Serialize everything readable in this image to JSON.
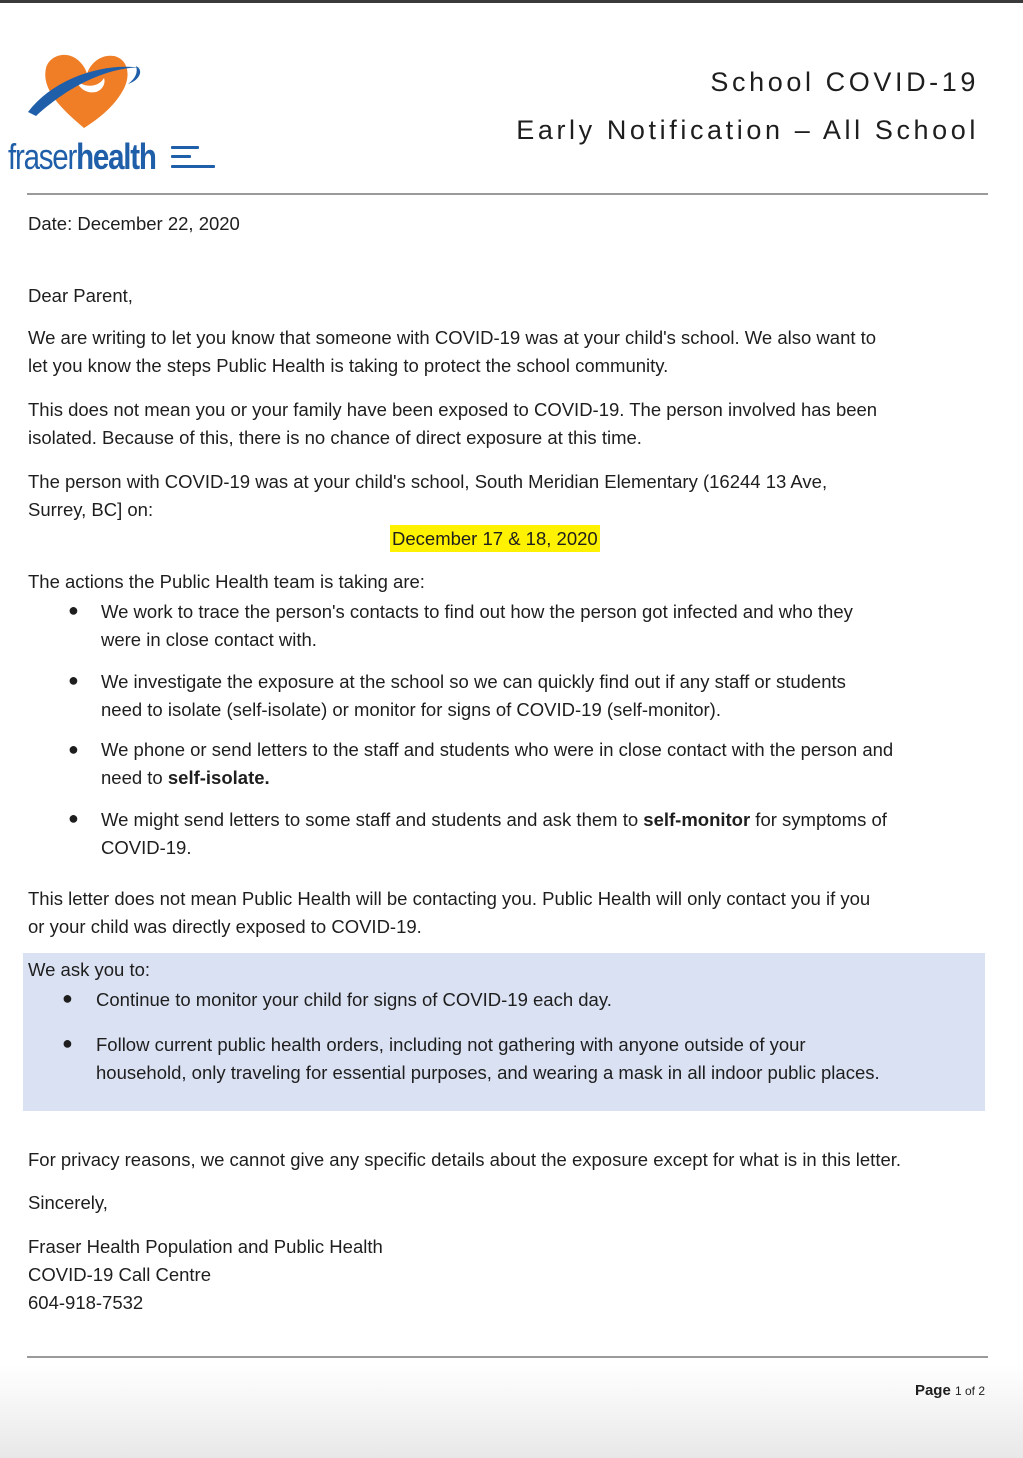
{
  "header": {
    "logo_word_light": "fraser",
    "logo_word_bold": "health",
    "title_line1": "School COVID-19",
    "title_line2": "Early Notification – All School"
  },
  "letter": {
    "date": "Date: December 22, 2020",
    "greeting": "Dear Parent,",
    "para1_line1": "We are writing to let you know that someone with COVID-19 was at your child's school. We also want to",
    "para1_line2": "let you know the steps Public Health is taking to protect the school community.",
    "para2_line1": "This does not mean you or your family have been exposed to COVID-19. The person involved has been",
    "para2_line2": "isolated. Because of this, there is no chance of direct exposure at this time.",
    "para3_line1": "The person with COVID-19 was at your child's school, South Meridian Elementary (16244 13 Ave,",
    "para3_line2": "Surrey, BC] on:",
    "exposure_dates": "December 17 & 18, 2020",
    "actions_intro": "The actions the Public Health team is taking are:",
    "actions": {
      "a1_l1": "We work to trace the person's contacts to find out how the person got infected and who they",
      "a1_l2": "were in close contact with.",
      "a2_l1": "We investigate the exposure at the school so we can quickly find out if any staff or students",
      "a2_l2": "need to isolate (self-isolate) or monitor for signs of COVID-19 (self-monitor).",
      "a3_l1": "We phone or send letters to the staff and students who were in close contact with the person and",
      "a3_l2_pre": "need to ",
      "a3_l2_bold": "self-isolate.",
      "a4_l1_pre": "We might send letters to some staff and students and ask them to ",
      "a4_l1_bold": "self-monitor",
      "a4_l1_post": " for symptoms of",
      "a4_l2": "COVID-19."
    },
    "para4_line1": "This letter does not mean Public Health will be contacting you. Public Health will only contact you if you",
    "para4_line2": "or your child was directly exposed to COVID-19.",
    "ask_intro": "We ask you to:",
    "ask": {
      "b1": "Continue to monitor your child for signs of COVID-19 each day.",
      "b2_l1": "Follow current public health orders, including not gathering with anyone outside of your",
      "b2_l2": "household, only traveling for essential purposes, and wearing a mask in all indoor public places."
    },
    "privacy": "For privacy reasons, we cannot give any specific details about the exposure except for what is in this letter.",
    "closing": "Sincerely,",
    "signature_line1": "Fraser Health Population and Public Health",
    "signature_line2": "COVID-19 Call Centre",
    "signature_phone": "604-918-7532"
  },
  "footer": {
    "page_label": "Page",
    "page_of": "1 of 2"
  },
  "colors": {
    "brand_blue": "#1f5ea8",
    "brand_orange": "#f07e26",
    "highlight": "#fff200",
    "shade": "#dae1f2"
  }
}
